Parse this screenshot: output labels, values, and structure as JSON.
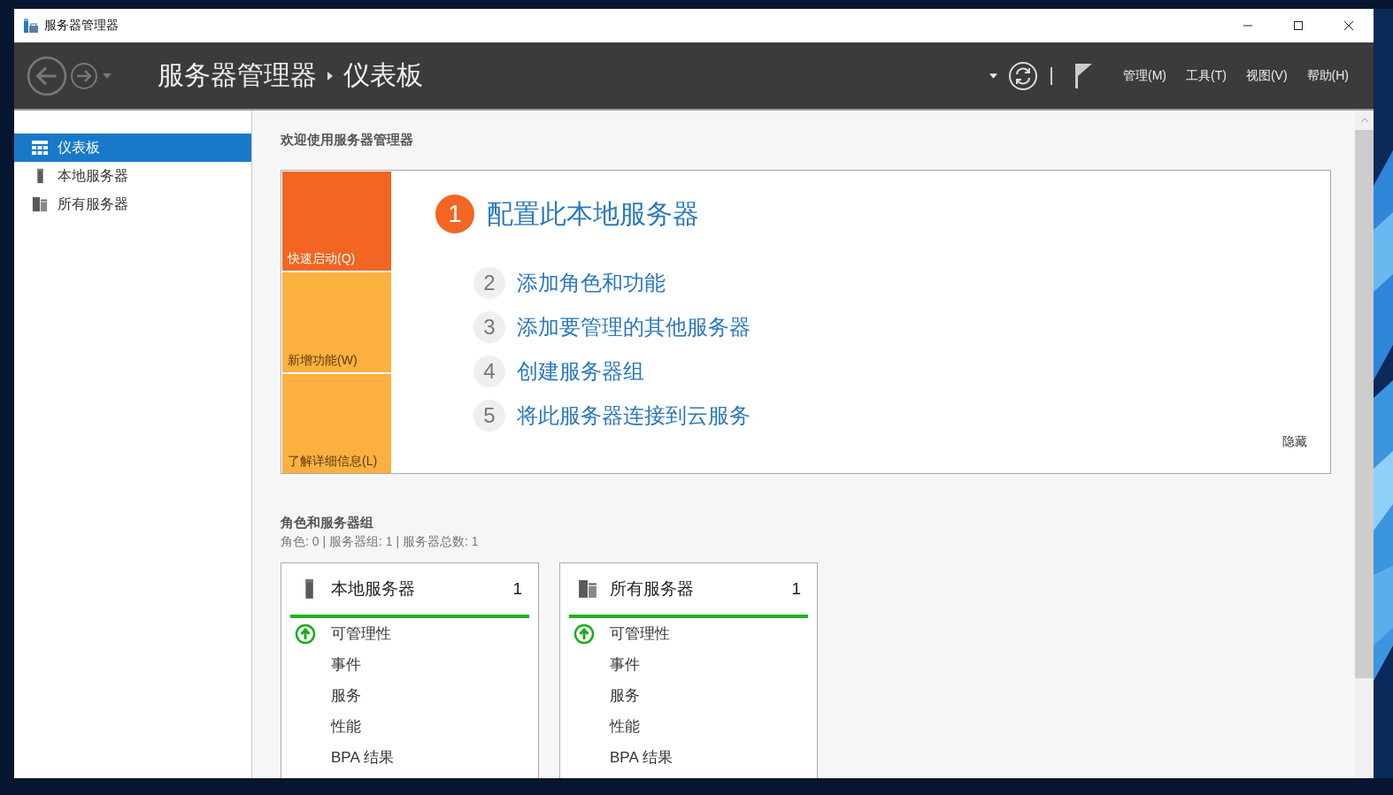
{
  "window": {
    "title": "服务器管理器"
  },
  "header": {
    "breadcrumb": [
      "服务器管理器",
      "仪表板"
    ],
    "menus": [
      "管理(M)",
      "工具(T)",
      "视图(V)",
      "帮助(H)"
    ]
  },
  "sidebar": {
    "items": [
      {
        "label": "仪表板",
        "kind": "dashboard",
        "selected": true
      },
      {
        "label": "本地服务器",
        "kind": "local",
        "selected": false
      },
      {
        "label": "所有服务器",
        "kind": "all",
        "selected": false
      }
    ]
  },
  "welcome": {
    "title": "欢迎使用服务器管理器",
    "tiles": [
      {
        "label": "快速启动(Q)",
        "selected": true
      },
      {
        "label": "新增功能(W)",
        "selected": false
      },
      {
        "label": "了解详细信息(L)",
        "selected": false
      }
    ],
    "steps": [
      {
        "number": "1",
        "label": "配置此本地服务器",
        "selected": true
      },
      {
        "number": "2",
        "label": "添加角色和功能",
        "selected": false
      },
      {
        "number": "3",
        "label": "添加要管理的其他服务器",
        "selected": false
      },
      {
        "number": "4",
        "label": "创建服务器组",
        "selected": false
      },
      {
        "number": "5",
        "label": "将此服务器连接到云服务",
        "selected": false
      }
    ],
    "hide_link": "隐藏"
  },
  "roles": {
    "title": "角色和服务器组",
    "summary": "角色: 0 | 服务器组: 1 | 服务器总数: 1",
    "cards": [
      {
        "title": "本地服务器",
        "kind": "local",
        "count": "1",
        "healthy": true,
        "items": [
          {
            "label": "可管理性",
            "ok": true
          },
          {
            "label": "事件",
            "ok": false
          },
          {
            "label": "服务",
            "ok": false
          },
          {
            "label": "性能",
            "ok": false
          },
          {
            "label": "BPA 结果",
            "ok": false
          }
        ]
      },
      {
        "title": "所有服务器",
        "kind": "all",
        "count": "1",
        "healthy": true,
        "items": [
          {
            "label": "可管理性",
            "ok": true
          },
          {
            "label": "事件",
            "ok": false
          },
          {
            "label": "服务",
            "ok": false
          },
          {
            "label": "性能",
            "ok": false
          },
          {
            "label": "BPA 结果",
            "ok": false
          }
        ]
      }
    ]
  }
}
